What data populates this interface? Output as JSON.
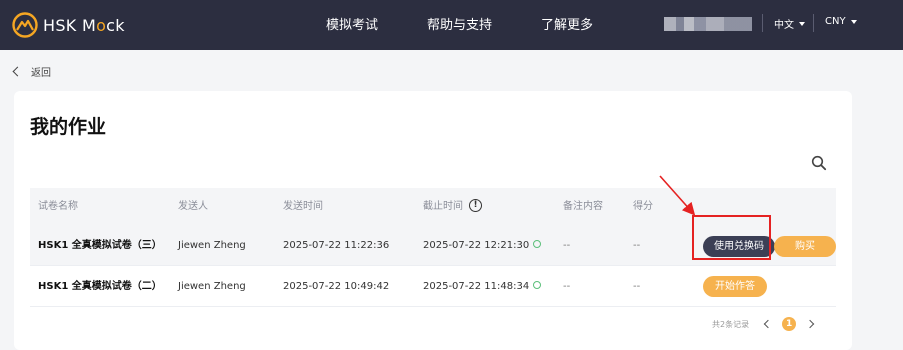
{
  "header": {
    "logo_prefix": "HSK M",
    "logo_o": "o",
    "logo_suffix": "ck",
    "nav": [
      "模拟考试",
      "帮助与支持",
      "了解更多"
    ],
    "language": "中文",
    "currency": "CNY"
  },
  "back_label": "返回",
  "page_title": "我的作业",
  "table": {
    "headers": [
      "试卷名称",
      "发送人",
      "发送时间",
      "截止时间",
      "备注内容",
      "得分"
    ],
    "rows": [
      {
        "name": "HSK1 全真模拟试卷（三）",
        "sender": "Jiewen Zheng",
        "sent": "2025-07-22 11:22:36",
        "deadline": "2025-07-22 12:21:30",
        "note": "--",
        "score": "--",
        "actions": [
          "使用兑换码",
          "购买"
        ]
      },
      {
        "name": "HSK1 全真模拟试卷（二）",
        "sender": "Jiewen Zheng",
        "sent": "2025-07-22 10:49:42",
        "deadline": "2025-07-22 11:48:34",
        "note": "--",
        "score": "--",
        "actions": [
          "开始作答"
        ]
      }
    ]
  },
  "pagination": {
    "total_label": "共2条记录",
    "current_page": "1"
  },
  "colors": {
    "header_bg": "#2c2e40",
    "accent": "#f6b24e",
    "dark_button": "#3b3f55",
    "annotation": "#e52222"
  }
}
